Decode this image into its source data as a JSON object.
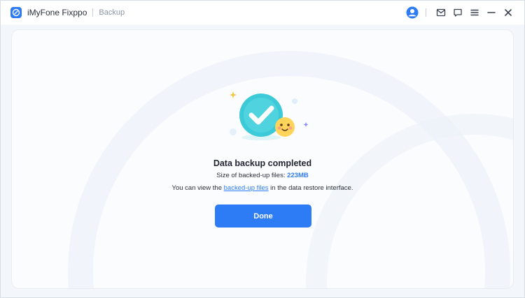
{
  "app": {
    "name": "iMyFone Fixppo",
    "breadcrumb": "Backup"
  },
  "titlebar": {
    "icons": [
      "account-icon",
      "mail-icon",
      "feedback-icon",
      "menu-icon",
      "minimize-icon",
      "close-icon"
    ]
  },
  "result": {
    "title": "Data backup completed",
    "size_prefix": "Size of backed-up files: ",
    "size_value": "223MB",
    "info_prefix": "You can view the ",
    "info_link": "backed-up files",
    "info_suffix": " in the data restore interface.",
    "done_label": "Done"
  },
  "colors": {
    "accent": "#2d7cf6",
    "check_circle": "#3cc9d8",
    "emoji": "#ffd45a"
  }
}
